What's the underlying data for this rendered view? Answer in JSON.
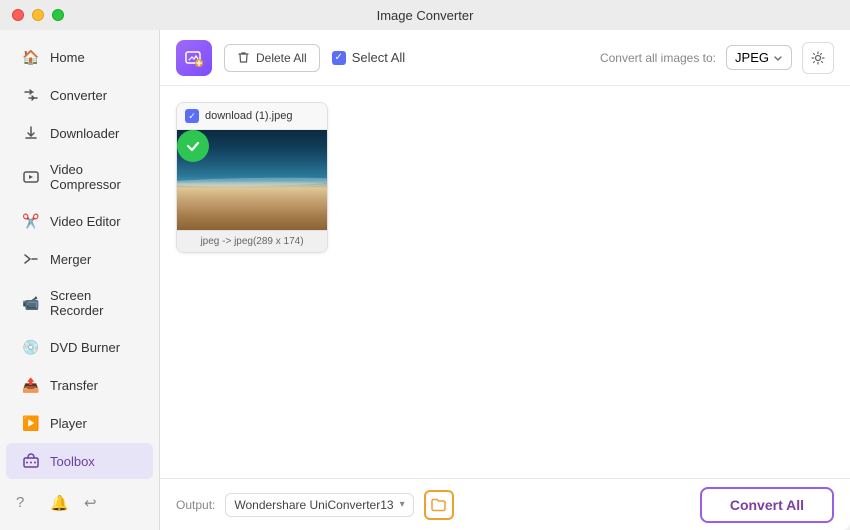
{
  "window": {
    "title": "Image Converter"
  },
  "sidebar": {
    "items": [
      {
        "id": "home",
        "label": "Home",
        "icon": "🏠"
      },
      {
        "id": "converter",
        "label": "Converter",
        "icon": "🔄",
        "active": false
      },
      {
        "id": "downloader",
        "label": "Downloader",
        "icon": "⬇️"
      },
      {
        "id": "video-compressor",
        "label": "Video Compressor",
        "icon": "🎬"
      },
      {
        "id": "video-editor",
        "label": "Video Editor",
        "icon": "✂️"
      },
      {
        "id": "merger",
        "label": "Merger",
        "icon": "🔀"
      },
      {
        "id": "screen-recorder",
        "label": "Screen Recorder",
        "icon": "📹"
      },
      {
        "id": "dvd-burner",
        "label": "DVD Burner",
        "icon": "💿"
      },
      {
        "id": "transfer",
        "label": "Transfer",
        "icon": "📤"
      },
      {
        "id": "player",
        "label": "Player",
        "icon": "▶️"
      },
      {
        "id": "toolbox",
        "label": "Toolbox",
        "icon": "🧰",
        "active": true
      }
    ],
    "bottom_icons": [
      "❓",
      "🔔",
      "↩️"
    ]
  },
  "toolbar": {
    "delete_all_label": "Delete All",
    "select_all_label": "Select All",
    "convert_to_label": "Convert all images to:",
    "format_value": "JPEG",
    "settings_icon": "⚙"
  },
  "file_list": [
    {
      "name": "download (1).jpeg",
      "checked": true,
      "format_info": "jpeg -> jpeg(289 x 174)"
    }
  ],
  "bottom_bar": {
    "output_label": "Output:",
    "output_path": "Wondershare UniConverter13",
    "convert_all_label": "Convert All"
  }
}
